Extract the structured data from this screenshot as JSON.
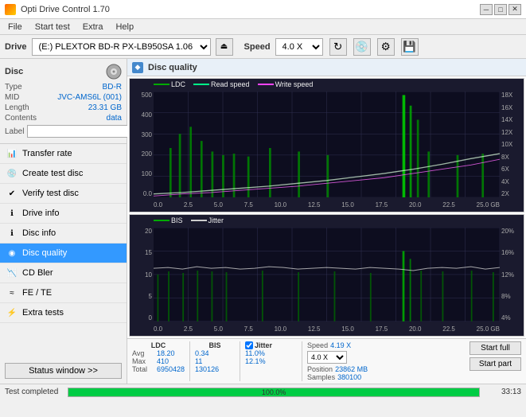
{
  "app": {
    "title": "Opti Drive Control 1.70",
    "icon": "disc-icon"
  },
  "titlebar": {
    "minimize": "─",
    "maximize": "□",
    "close": "✕"
  },
  "menu": {
    "items": [
      "File",
      "Start test",
      "Extra",
      "Help"
    ]
  },
  "drive_bar": {
    "drive_label": "Drive",
    "drive_value": "(E:) PLEXTOR BD-R  PX-LB950SA 1.06",
    "speed_label": "Speed",
    "speed_value": "4.0 X"
  },
  "sidebar": {
    "disc_section": {
      "title": "Disc",
      "rows": [
        {
          "label": "Type",
          "value": "BD-R"
        },
        {
          "label": "MID",
          "value": "JVC-AMS6L (001)"
        },
        {
          "label": "Length",
          "value": "23.31 GB"
        },
        {
          "label": "Contents",
          "value": "data"
        },
        {
          "label": "Label",
          "value": ""
        }
      ]
    },
    "nav_items": [
      {
        "id": "transfer-rate",
        "label": "Transfer rate",
        "active": false
      },
      {
        "id": "create-test-disc",
        "label": "Create test disc",
        "active": false
      },
      {
        "id": "verify-test-disc",
        "label": "Verify test disc",
        "active": false
      },
      {
        "id": "drive-info",
        "label": "Drive info",
        "active": false
      },
      {
        "id": "disc-info",
        "label": "Disc info",
        "active": false
      },
      {
        "id": "disc-quality",
        "label": "Disc quality",
        "active": true
      },
      {
        "id": "cd-bler",
        "label": "CD Bler",
        "active": false
      },
      {
        "id": "fe-te",
        "label": "FE / TE",
        "active": false
      },
      {
        "id": "extra-tests",
        "label": "Extra tests",
        "active": false
      }
    ],
    "status_btn": "Status window >>"
  },
  "content": {
    "header": {
      "icon": "◆",
      "title": "Disc quality"
    },
    "chart1": {
      "legend": [
        {
          "label": "LDC",
          "color": "#00aa00"
        },
        {
          "label": "Read speed",
          "color": "#00ff88"
        },
        {
          "label": "Write speed",
          "color": "#ff44ff"
        }
      ],
      "y_labels_left": [
        "500",
        "400",
        "300",
        "200",
        "100",
        "0.0"
      ],
      "y_labels_right": [
        "18X",
        "16X",
        "14X",
        "12X",
        "10X",
        "8X",
        "6X",
        "4X",
        "2X"
      ],
      "x_labels": [
        "0.0",
        "2.5",
        "5.0",
        "7.5",
        "10.0",
        "12.5",
        "15.0",
        "17.5",
        "20.0",
        "22.5",
        "25.0 GB"
      ]
    },
    "chart2": {
      "legend": [
        {
          "label": "BIS",
          "color": "#00aa00"
        },
        {
          "label": "Jitter",
          "color": "#cccccc"
        }
      ],
      "y_labels_left": [
        "20",
        "15",
        "10",
        "5",
        "0"
      ],
      "y_labels_right": [
        "20%",
        "16%",
        "12%",
        "8%",
        "4%"
      ],
      "x_labels": [
        "0.0",
        "2.5",
        "5.0",
        "7.5",
        "10.0",
        "12.5",
        "15.0",
        "17.5",
        "20.0",
        "22.5",
        "25.0 GB"
      ]
    },
    "stats": {
      "ldc_label": "LDC",
      "bis_label": "BIS",
      "jitter_label": "Jitter",
      "speed_label": "Speed",
      "rows": [
        {
          "label": "Avg",
          "ldc": "18.20",
          "bis": "0.34",
          "jitter": "11.0%"
        },
        {
          "label": "Max",
          "ldc": "410",
          "bis": "11",
          "jitter": "12.1%"
        },
        {
          "label": "Total",
          "ldc": "6950428",
          "bis": "130126",
          "jitter": ""
        }
      ],
      "speed_value": "4.19 X",
      "speed_select": "4.0 X",
      "position_label": "Position",
      "position_value": "23862 MB",
      "samples_label": "Samples",
      "samples_value": "380100",
      "btn_start_full": "Start full",
      "btn_start_part": "Start part"
    }
  },
  "statusbar": {
    "text": "Test completed",
    "progress": 100,
    "progress_text": "100.0%",
    "time": "33:13"
  }
}
